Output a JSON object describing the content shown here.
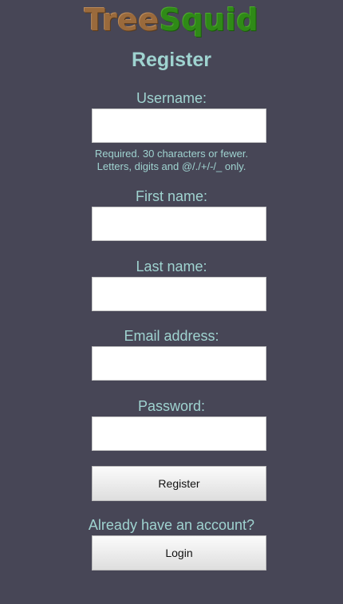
{
  "brand": {
    "part1": "Tree",
    "part2": "Squid",
    "colors": {
      "tree": "#9a6a3c",
      "squid": "#2f8a17"
    }
  },
  "page": {
    "title": "Register",
    "background": "#474656",
    "accent": "#9fd3d0"
  },
  "form": {
    "username": {
      "label": "Username:",
      "value": "",
      "help_line1": "Required. 30 characters or fewer.",
      "help_line2": "Letters, digits and @/./+/-/_ only."
    },
    "first_name": {
      "label": "First name:",
      "value": ""
    },
    "last_name": {
      "label": "Last name:",
      "value": ""
    },
    "email": {
      "label": "Email address:",
      "value": ""
    },
    "password": {
      "label": "Password:",
      "value": ""
    },
    "submit_label": "Register"
  },
  "login": {
    "prompt": "Already have an account?",
    "button_label": "Login"
  }
}
